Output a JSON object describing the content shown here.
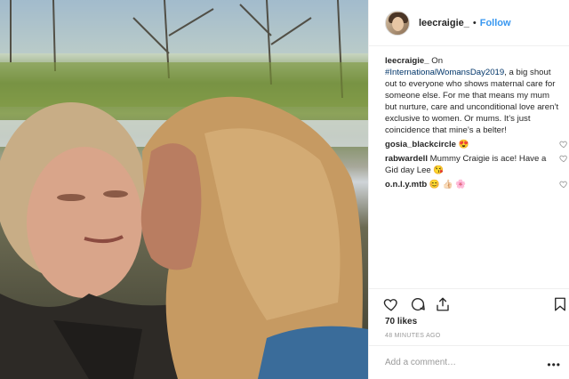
{
  "header": {
    "username": "leecraigie_",
    "separator": "•",
    "follow_label": "Follow"
  },
  "caption": {
    "username": "leecraigie_",
    "text_before": " On ",
    "hashtag": "#InternationalWomansDay2019",
    "text_after": ", a big shout out to everyone who shows maternal care for someone else. For me that means my mum but nurture, care and unconditional love aren’t exclusive to women. Or mums. It’s just coincidence that mine’s a belter!"
  },
  "comments": [
    {
      "username": "gosia_blackcircle",
      "text": " 😍"
    },
    {
      "username": "rabwardell",
      "text": " Mummy Craigie is ace! Have a Gid day Lee 😘"
    },
    {
      "username": "o.n.l.y.mtb",
      "text": " 😊 👍🏻 🌸"
    }
  ],
  "actions": {
    "like_icon": "heart-icon",
    "comment_icon": "comment-icon",
    "share_icon": "share-icon",
    "save_icon": "bookmark-icon"
  },
  "likes": "70 likes",
  "time": "48 MINUTES AGO",
  "add_comment": {
    "placeholder": "Add a comment…",
    "more": "•••"
  },
  "colors": {
    "accent": "#3897f0",
    "text": "#262626",
    "muted": "#999999"
  }
}
